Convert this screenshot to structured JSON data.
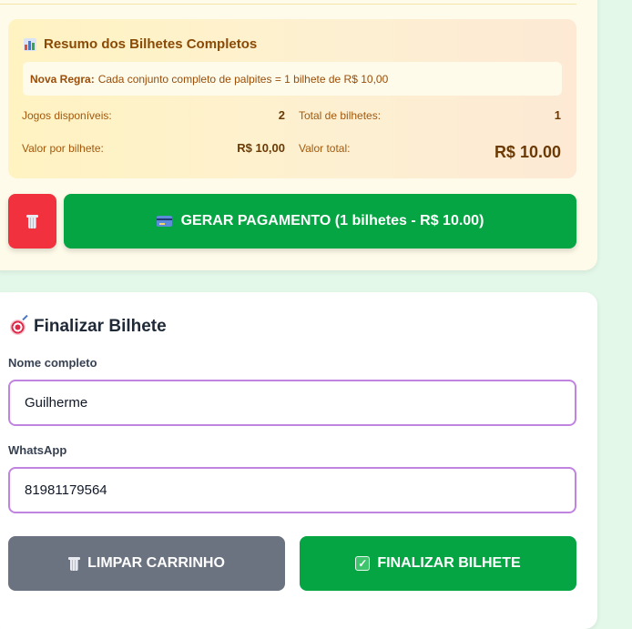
{
  "summary": {
    "title": "Resumo dos Bilhetes Completos",
    "rule_label": "Nova Regra:",
    "rule_text": "Cada conjunto completo de palpites = 1 bilhete de R$ 10,00",
    "games_available_label": "Jogos disponíveis:",
    "games_available_value": "2",
    "total_tickets_label": "Total de bilhetes:",
    "total_tickets_value": "1",
    "price_per_ticket_label": "Valor por bilhete:",
    "price_per_ticket_value": "R$ 10,00",
    "total_value_label": "Valor total:",
    "total_value_value": "R$ 10.00"
  },
  "actions": {
    "pay_label": "GERAR PAGAMENTO (1 bilhetes - R$ 10.00)"
  },
  "finalize": {
    "title": "Finalizar Bilhete",
    "name_label": "Nome completo",
    "name_value": "Guilherme",
    "whatsapp_label": "WhatsApp",
    "whatsapp_value": "81981179564",
    "clear_label": "LIMPAR CARRINHO",
    "finish_label": "FINALIZAR BILHETE"
  },
  "colors": {
    "accent_green": "#05a544",
    "danger_red": "#f2313f",
    "neutral_gray": "#6b7280",
    "field_border": "#c084e0"
  }
}
